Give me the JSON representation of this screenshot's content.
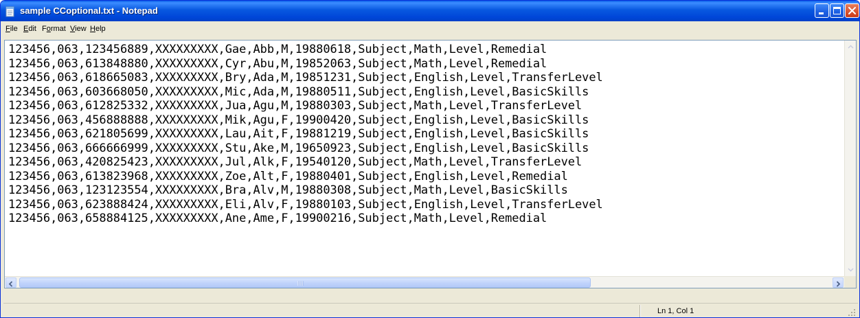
{
  "window": {
    "title": "sample CCoptional.txt - Notepad"
  },
  "menu": {
    "items": [
      {
        "label": "File",
        "hotkey": "F",
        "rest": "ile"
      },
      {
        "label": "Edit",
        "hotkey": "E",
        "rest": "dit"
      },
      {
        "label": "Format",
        "hotkey": "o",
        "pre": "F",
        "rest": "rmat"
      },
      {
        "label": "View",
        "hotkey": "V",
        "rest": "iew"
      },
      {
        "label": "Help",
        "hotkey": "H",
        "rest": "elp"
      }
    ]
  },
  "editor": {
    "lines": [
      "123456,063,123456889,XXXXXXXXX,Gae,Abb,M,19880618,Subject,Math,Level,Remedial",
      "123456,063,613848880,XXXXXXXXX,Cyr,Abu,M,19852063,Subject,Math,Level,Remedial",
      "123456,063,618665083,XXXXXXXXX,Bry,Ada,M,19851231,Subject,English,Level,TransferLevel",
      "123456,063,603668050,XXXXXXXXX,Mic,Ada,M,19880511,Subject,English,Level,BasicSkills",
      "123456,063,612825332,XXXXXXXXX,Jua,Agu,M,19880303,Subject,Math,Level,TransferLevel",
      "123456,063,456888888,XXXXXXXXX,Mik,Agu,F,19900420,Subject,English,Level,BasicSkills",
      "123456,063,621805699,XXXXXXXXX,Lau,Ait,F,19881219,Subject,English,Level,BasicSkills",
      "123456,063,666666999,XXXXXXXXX,Stu,Ake,M,19650923,Subject,English,Level,BasicSkills",
      "123456,063,420825423,XXXXXXXXX,Jul,Alk,F,19540120,Subject,Math,Level,TransferLevel",
      "123456,063,613823968,XXXXXXXXX,Zoe,Alt,F,19880401,Subject,English,Level,Remedial",
      "123456,063,123123554,XXXXXXXXX,Bra,Alv,M,19880308,Subject,Math,Level,BasicSkills",
      "123456,063,623888424,XXXXXXXXX,Eli,Alv,F,19880103,Subject,English,Level,TransferLevel",
      "123456,063,658884125,XXXXXXXXX,Ane,Ame,F,19900216,Subject,Math,Level,Remedial"
    ]
  },
  "statusbar": {
    "position": "Ln 1, Col 1"
  },
  "icons": {
    "app": "notepad-icon",
    "minimize": "minimize-icon",
    "maximize": "maximize-icon",
    "close": "close-icon"
  },
  "colors": {
    "titlebar": "#0054E3",
    "chrome": "#ECE9D8",
    "close_button": "#D9532E"
  }
}
